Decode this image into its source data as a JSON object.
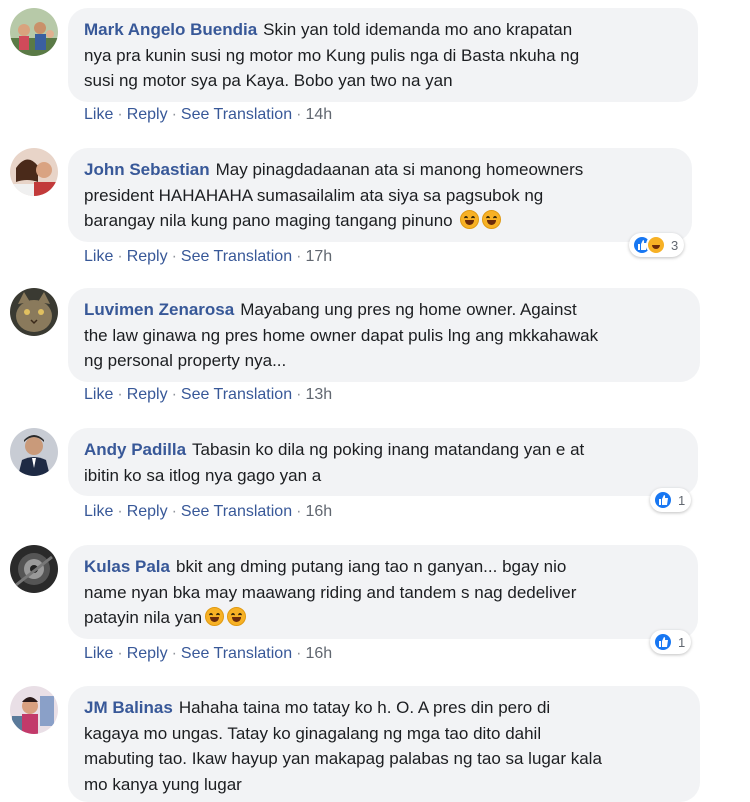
{
  "actions": {
    "like": "Like",
    "reply": "Reply",
    "translate": "See Translation",
    "dot": "·"
  },
  "comments": [
    {
      "author": "Mark Angelo Buendia",
      "lines": [
        "Skin yan told idemanda mo ano krapatan",
        "nya pra kunin susi ng motor mo Kung pulis nga di Basta nkuha ng",
        "susi ng motor sya pa Kaya. Bobo yan two na yan"
      ],
      "time": "14h"
    },
    {
      "author": "John Sebastian",
      "lines": [
        "May pinagdadaanan ata si manong homeowners",
        "president HAHAHAHA sumasailalim ata siya sa pagsubok ng",
        "barangay nila kung pano maging tangang pinuno"
      ],
      "time": "17h",
      "reaction_count": "3"
    },
    {
      "author": "Luvimen Zenarosa",
      "lines": [
        "Mayabang ung pres ng home owner. Against",
        "the law ginawa ng pres home owner dapat pulis lng ang mkkahawak",
        "ng personal property nya..."
      ],
      "time": "13h"
    },
    {
      "author": "Andy Padilla",
      "lines": [
        "Tabasin ko dila ng poking inang matandang yan e at",
        "ibitin ko sa itlog nya gago yan a"
      ],
      "time": "16h",
      "reaction_count": "1"
    },
    {
      "author": "Kulas Pala",
      "lines": [
        "bkit ang dming putang iang tao n ganyan... bgay nio",
        "name nyan bka may maawang riding and tandem s nag dedeliver",
        "patayin nila yan"
      ],
      "time": "16h",
      "reaction_count": "1"
    },
    {
      "author": "JM Balinas",
      "lines": [
        "Hahaha taina mo tatay ko h. O. A pres din pero di",
        "kagaya mo ungas. Tatay ko ginagalang ng mga tao dito dahil",
        "mabuting tao. Ikaw hayup yan makapag palabas ng tao sa lugar kala",
        "mo kanya yung lugar"
      ]
    }
  ],
  "colors": {
    "link": "#385898",
    "bubble": "#f2f3f5",
    "like": "#1877f2",
    "haha": "#f7b125"
  }
}
